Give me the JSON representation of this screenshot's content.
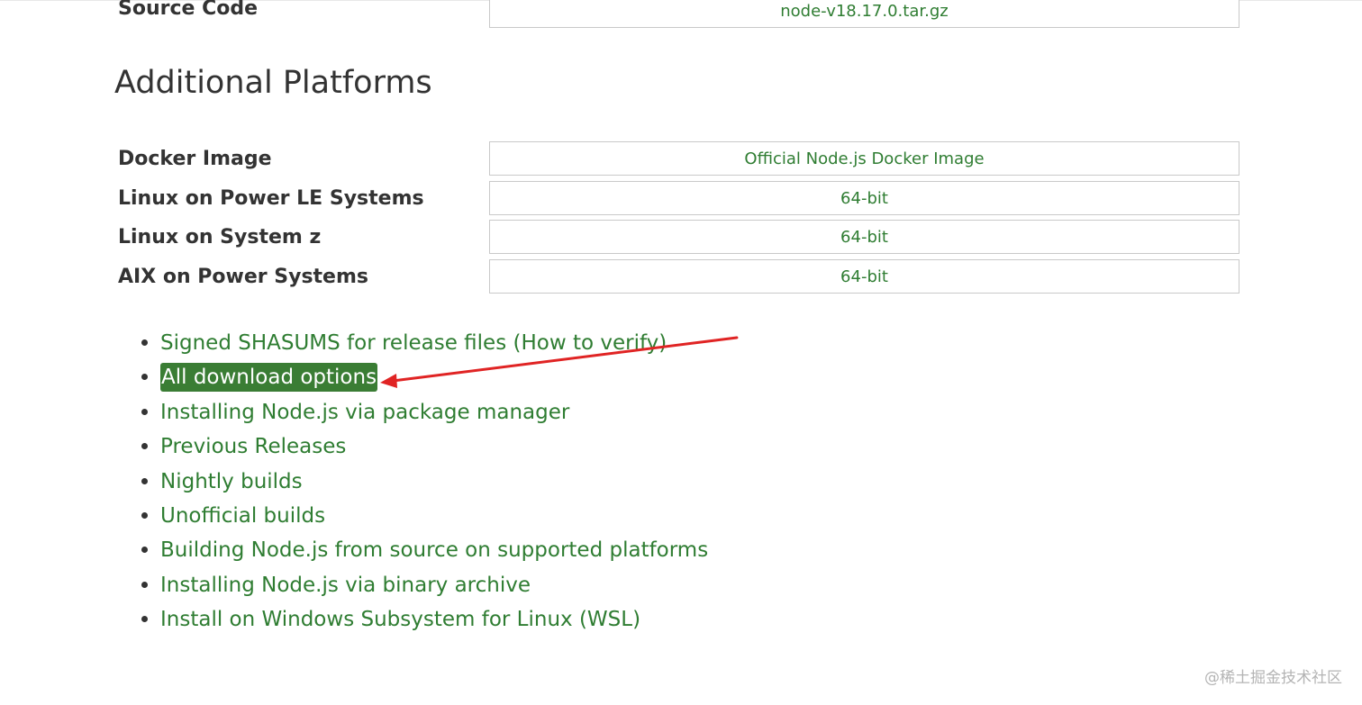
{
  "source_code": {
    "label": "Source Code",
    "file": "node-v18.17.0.tar.gz"
  },
  "additional_platforms": {
    "title": "Additional Platforms",
    "rows": [
      {
        "label": "Docker Image",
        "value": "Official Node.js Docker Image"
      },
      {
        "label": "Linux on Power LE Systems",
        "value": "64-bit"
      },
      {
        "label": "Linux on System z",
        "value": "64-bit"
      },
      {
        "label": "AIX on Power Systems",
        "value": "64-bit"
      }
    ]
  },
  "links": [
    "Signed SHASUMS for release files (How to verify)",
    "All download options",
    "Installing Node.js via package manager",
    "Previous Releases",
    "Nightly builds",
    "Unofficial builds",
    "Building Node.js from source on supported platforms",
    "Installing Node.js via binary archive",
    "Install on Windows Subsystem for Linux (WSL)"
  ],
  "annotation": {
    "arrow_color": "#e02424",
    "highlight_color": "#3a7d34",
    "link_color": "#2f7d32"
  },
  "watermark": "@稀土掘金技术社区"
}
